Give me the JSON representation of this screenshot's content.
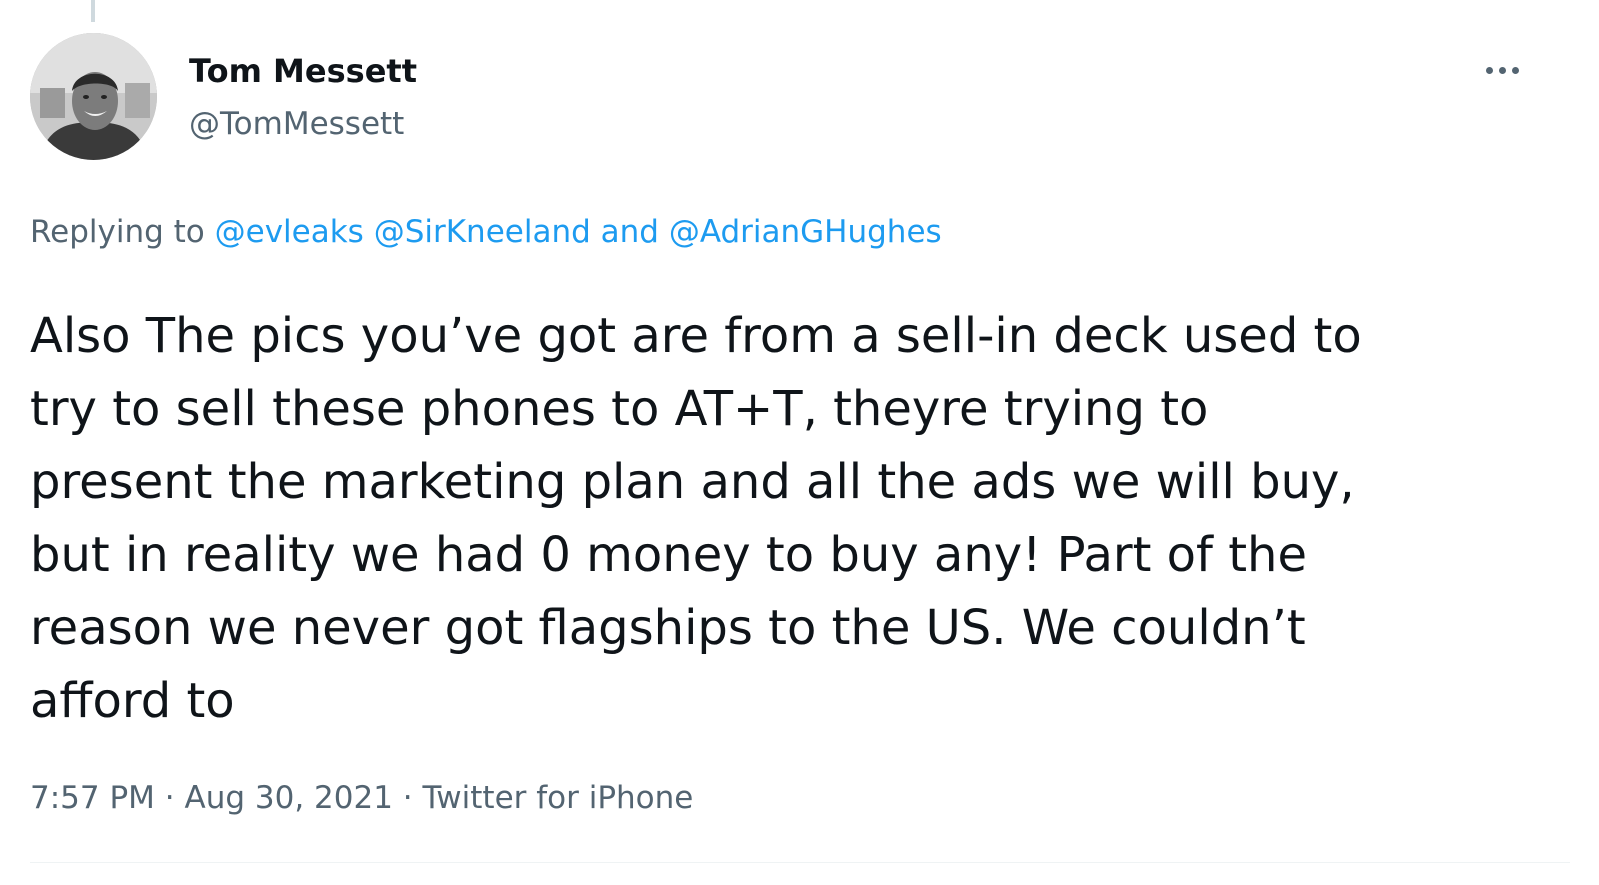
{
  "author": {
    "display_name": "Tom Messett",
    "handle": "@TomMessett"
  },
  "more_icon": "ellipsis-icon",
  "reply": {
    "prefix": "Replying to ",
    "mention_1": "@evleaks",
    "mention_2": "@SirKneeland",
    "conjunction": " and ",
    "mention_3": "@AdrianGHughes"
  },
  "tweet": {
    "line_1": "Also The pics you’ve got are from a sell-in deck used to",
    "line_2": "try to sell these phones to AT+T, theyre trying to",
    "line_3": "present the marketing plan and all the ads we will buy,",
    "line_4": "but in reality we had 0 money to buy any! Part of the",
    "line_5": "reason we never got flagships to the US. We couldn’t",
    "line_6": "afford to"
  },
  "meta": {
    "time": "7:57 PM",
    "separator_1": " · ",
    "date": "Aug 30, 2021",
    "separator_2": " · ",
    "source": "Twitter for iPhone"
  },
  "colors": {
    "link": "#1d9bf0",
    "secondary": "#536471",
    "text": "#0f1419"
  }
}
